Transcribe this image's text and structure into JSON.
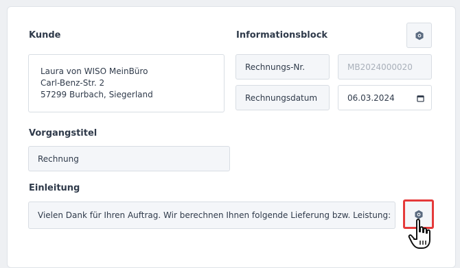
{
  "customer": {
    "label": "Kunde",
    "address_lines": [
      "Laura von WISO MeinBüro",
      "Carl-Benz-Str. 2",
      "57299 Burbach, Siegerland"
    ]
  },
  "info_block": {
    "label": "Informationsblock",
    "invoice_number_label": "Rechnungs-Nr.",
    "invoice_number_placeholder": "MB2024000020",
    "invoice_date_label": "Rechnungsdatum",
    "invoice_date_value": "06.03.2024"
  },
  "title_section": {
    "label": "Vorgangstitel",
    "value": "Rechnung"
  },
  "intro_section": {
    "label": "Einleitung",
    "value": "Vielen Dank für Ihren Auftrag. Wir berechnen Ihnen folgende Lieferung bzw. Leistung:"
  },
  "icons": {
    "settings": "gear-icon",
    "calendar": "calendar-icon",
    "cursor": "hand-pointer-cursor"
  },
  "colors": {
    "highlight": "#e53a3a",
    "icon": "#5b6b80"
  }
}
